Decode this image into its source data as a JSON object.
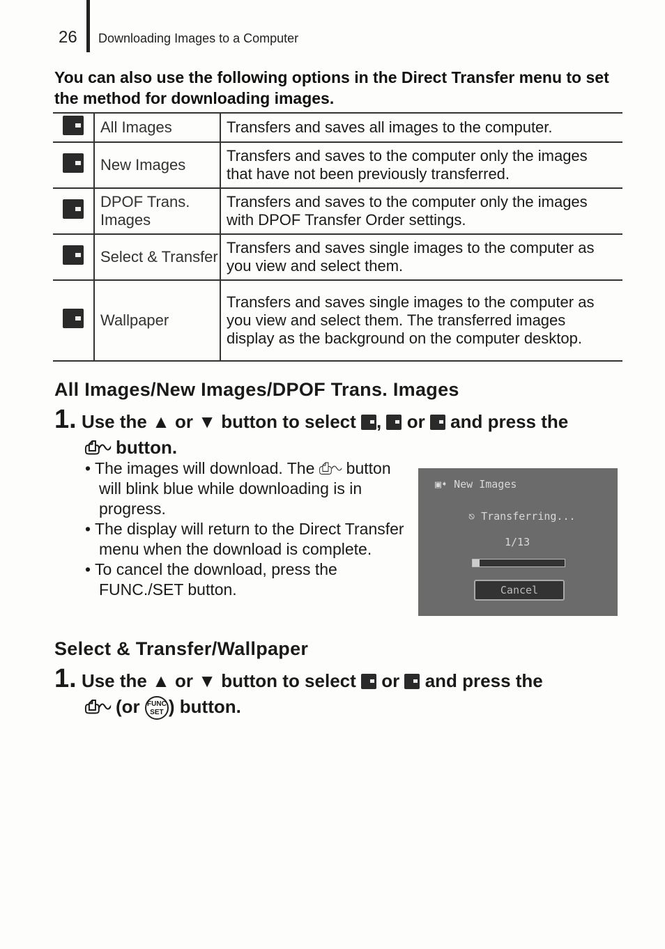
{
  "header": {
    "page_number": "26",
    "running_title": "Downloading Images to a Computer"
  },
  "intro": "You can also use the following options in the Direct Transfer menu to set the method for downloading images.",
  "options_table": [
    {
      "icon": "all-images-icon",
      "name": "All Images",
      "description": "Transfers and saves all images to the computer."
    },
    {
      "icon": "new-images-icon",
      "name": "New Images",
      "description": "Transfers and saves to the computer only the images that have not been previously transferred."
    },
    {
      "icon": "dpof-images-icon",
      "name": "DPOF Trans. Images",
      "description": "Transfers and saves to the computer only the images with DPOF Transfer Order settings."
    },
    {
      "icon": "select-transfer-icon",
      "name": "Select & Transfer",
      "description": "Transfers and saves single images to the computer as you view and select them."
    },
    {
      "icon": "wallpaper-icon",
      "name": "Wallpaper",
      "description": "Transfers and saves single images to the computer as you view and select them. The transferred images display as the background on the computer desktop."
    }
  ],
  "section1": {
    "heading": "All Images/New Images/DPOF Trans. Images",
    "step_number": "1.",
    "step_text_a": "Use the ▲ or ▼ button to select",
    "step_text_b": "or",
    "step_text_c": "and press the",
    "step_text_d": "button.",
    "print_share_symbol": "⎙∿",
    "bullets": [
      "The images will download. The ⎙∿ button will blink blue while downloading is in progress.",
      "The display will return to the Direct Transfer menu when the download is complete.",
      "To cancel the download, press the FUNC./SET button."
    ],
    "camera_screen": {
      "title": "New Images",
      "status": "Transferring...",
      "count": "1/13",
      "progress_fraction": 0.077,
      "cancel_label": "Cancel"
    }
  },
  "section2": {
    "heading": "Select & Transfer/Wallpaper",
    "step_number": "1.",
    "step_text_a": "Use the ▲ or ▼ button to select",
    "step_text_b": "or",
    "step_text_c": "and press the",
    "step_text_d": "(or",
    "step_text_e": ") button.",
    "func_set_label": "FUNC SET"
  }
}
